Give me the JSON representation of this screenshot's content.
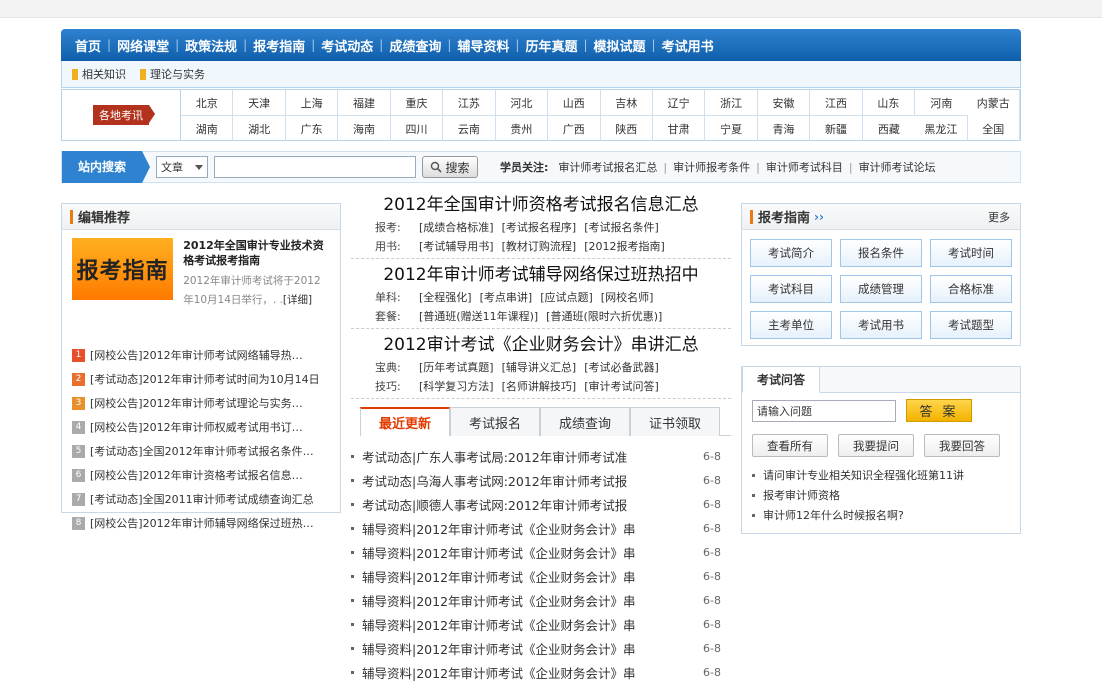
{
  "nav": [
    "首页",
    "网络课堂",
    "政策法规",
    "报考指南",
    "考试动态",
    "成绩查询",
    "辅导资料",
    "历年真题",
    "模拟试题",
    "考试用书"
  ],
  "subnav": [
    "相关知识",
    "理论与实务"
  ],
  "region": {
    "label": "各地考讯",
    "row1": [
      "北京",
      "天津",
      "上海",
      "福建",
      "重庆",
      "江苏",
      "河北",
      "山西",
      "吉林",
      "辽宁",
      "浙江",
      "安徽",
      "江西",
      "山东",
      "河南",
      "内蒙古"
    ],
    "row2": [
      "湖南",
      "湖北",
      "广东",
      "海南",
      "四川",
      "云南",
      "贵州",
      "广西",
      "陕西",
      "甘肃",
      "宁夏",
      "青海",
      "新疆",
      "西藏",
      "黑龙江",
      "全国"
    ]
  },
  "search": {
    "label": "站内搜索",
    "select_value": "文章",
    "input_value": "",
    "button": "搜索",
    "focus_label": "学员关注:",
    "focus_links": [
      "审计师考试报名汇总",
      "审计师报考条件",
      "审计师考试科目",
      "审计师考试论坛"
    ]
  },
  "editor": {
    "title": "编辑推荐",
    "image_text": "报考指南",
    "feature_title": "2012年全国审计专业技术资格考试报考指南",
    "feature_desc": "2012年审计师考试将于2012年10月14日举行，. .",
    "detail_link": "[详细]",
    "items": [
      {
        "n": "1",
        "text": "[网校公告]2012年审计师考试网络辅导热…"
      },
      {
        "n": "2",
        "text": "[考试动态]2012年审计师考试时间为10月14日"
      },
      {
        "n": "3",
        "text": "[网校公告]2012年审计师考试理论与实务…"
      },
      {
        "n": "4",
        "text": "[网校公告]2012年审计师权威考试用书订…"
      },
      {
        "n": "5",
        "text": "[考试动态]全国2012年审计师考试报名条件…"
      },
      {
        "n": "6",
        "text": "[网校公告]2012年审计资格考试报名信息…"
      },
      {
        "n": "7",
        "text": "[考试动态]全国2011审计师考试成绩查询汇总"
      },
      {
        "n": "8",
        "text": "[网校公告]2012年审计师辅导网络保过班热…"
      }
    ]
  },
  "headlines": [
    {
      "title": "2012年全国审计师资格考试报名信息汇总",
      "rows": [
        {
          "label": "报考:",
          "links": [
            "[成绩合格标准]",
            "[考试报名程序]",
            "[考试报名条件]"
          ]
        },
        {
          "label": "用书:",
          "links": [
            "[考试辅导用书]",
            "[教材订购流程]",
            "[2012报考指南]"
          ]
        }
      ]
    },
    {
      "title": "2012年审计师考试辅导网络保过班热招中",
      "rows": [
        {
          "label": "单科:",
          "links": [
            "[全程强化]",
            "[考点串讲]",
            "[应试点题]",
            "[网校名师]"
          ]
        },
        {
          "label": "套餐:",
          "links": [
            "[普通班(赠送11年课程)]",
            "[普通班(限时六折优惠)]"
          ]
        }
      ]
    },
    {
      "title": "2012审计考试《企业财务会计》串讲汇总",
      "rows": [
        {
          "label": "宝典:",
          "links": [
            "[历年考试真题]",
            "[辅导讲义汇总]",
            "[考试必备武器]"
          ]
        },
        {
          "label": "技巧:",
          "links": [
            "[科学复习方法]",
            "[名师讲解技巧]",
            "[审计考试问答]"
          ]
        }
      ]
    }
  ],
  "tabs": [
    "最近更新",
    "考试报名",
    "成绩查询",
    "证书领取"
  ],
  "news": [
    {
      "text": "考试动态|广东人事考试局:2012年审计师考试准",
      "date": "6-8"
    },
    {
      "text": "考试动态|乌海人事考试网:2012年审计师考试报",
      "date": "6-8"
    },
    {
      "text": "考试动态|顺德人事考试网:2012年审计师考试报",
      "date": "6-8"
    },
    {
      "text": "辅导资料|2012年审计师考试《企业财务会计》串",
      "date": "6-8"
    },
    {
      "text": "辅导资料|2012年审计师考试《企业财务会计》串",
      "date": "6-8"
    },
    {
      "text": "辅导资料|2012年审计师考试《企业财务会计》串",
      "date": "6-8"
    },
    {
      "text": "辅导资料|2012年审计师考试《企业财务会计》串",
      "date": "6-8"
    },
    {
      "text": "辅导资料|2012年审计师考试《企业财务会计》串",
      "date": "6-8"
    },
    {
      "text": "辅导资料|2012年审计师考试《企业财务会计》串",
      "date": "6-8"
    },
    {
      "text": "辅导资料|2012年审计师考试《企业财务会计》串",
      "date": "6-8"
    }
  ],
  "guide": {
    "title": "报考指南",
    "more": "更多",
    "buttons": [
      "考试简介",
      "报名条件",
      "考试时间",
      "考试科目",
      "成绩管理",
      "合格标准",
      "主考单位",
      "考试用书",
      "考试题型"
    ]
  },
  "qa": {
    "tab": "考试问答",
    "input_value": "请输入问题",
    "submit": "答 案",
    "buttons": [
      "查看所有",
      "我要提问",
      "我要回答"
    ],
    "items": [
      "请问审计专业相关知识全程强化班第11讲",
      "报考审计师资格",
      "审计师12年什么时候报名啊?"
    ]
  },
  "colors": {
    "nav_blue": "#1565b5",
    "accent_orange": "#e87a10",
    "active_tab": "#e23c00",
    "num_colors": [
      "#e8502c",
      "#e8702c",
      "#e8902c",
      "#aaaaaa",
      "#aaaaaa",
      "#aaaaaa",
      "#aaaaaa",
      "#aaaaaa"
    ]
  }
}
